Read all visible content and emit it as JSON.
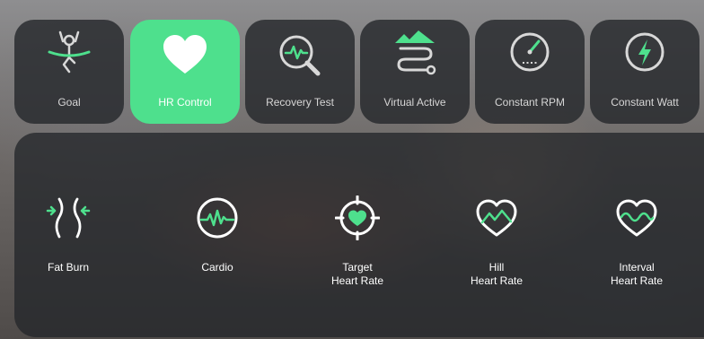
{
  "modes": [
    {
      "label": "Goal",
      "icon": "goal-cyclist-icon",
      "active": false
    },
    {
      "label": "HR Control",
      "icon": "heart-icon",
      "active": true
    },
    {
      "label": "Recovery Test",
      "icon": "heart-rate-search-icon",
      "active": false
    },
    {
      "label": "Virtual Active",
      "icon": "mountain-route-icon",
      "active": false
    },
    {
      "label": "Constant RPM",
      "icon": "speedometer-icon",
      "active": false
    },
    {
      "label": "Constant Watt",
      "icon": "lightning-icon",
      "active": false
    }
  ],
  "hr_programs": [
    {
      "line1": "Fat Burn",
      "line2": "",
      "icon": "fat-burn-icon"
    },
    {
      "line1": "Cardio",
      "line2": "",
      "icon": "cardio-pulse-icon"
    },
    {
      "line1": "Target",
      "line2": "Heart Rate",
      "icon": "target-heart-icon"
    },
    {
      "line1": "Hill",
      "line2": "Heart Rate",
      "icon": "hill-heart-icon"
    },
    {
      "line1": "Interval",
      "line2": "Heart Rate",
      "icon": "interval-heart-icon"
    }
  ],
  "colors": {
    "accent": "#4ee08d",
    "tile": "#26282c",
    "text": "#ffffff"
  }
}
